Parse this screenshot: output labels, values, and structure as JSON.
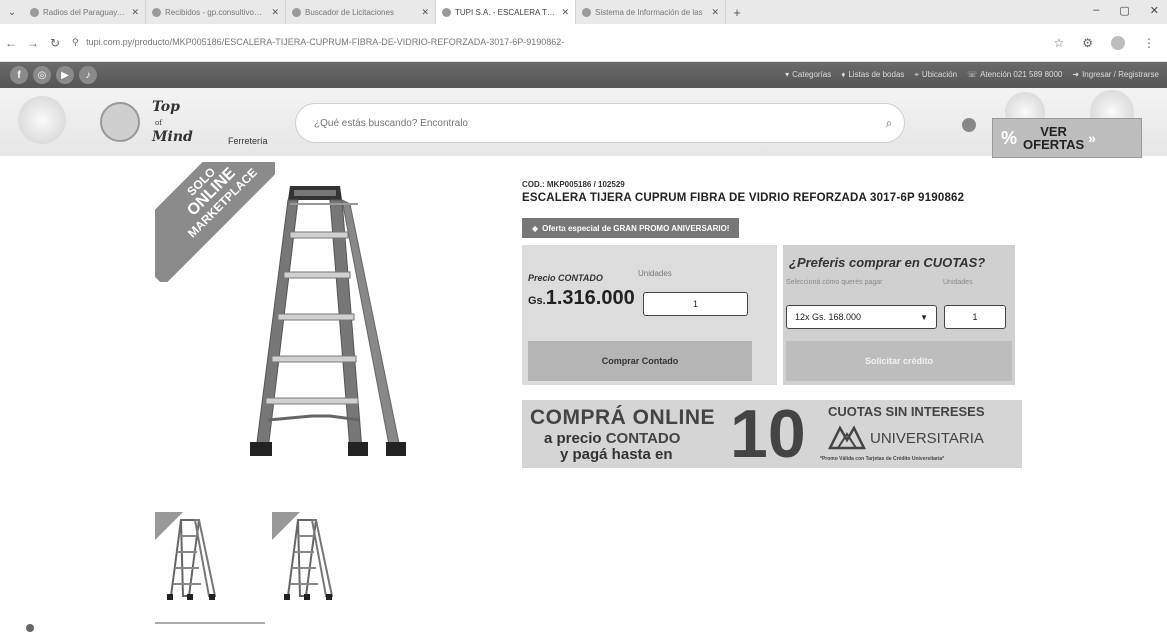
{
  "browser": {
    "tabs": [
      {
        "title": "Radios del Paraguay, emis",
        "active": false
      },
      {
        "title": "Recibidos - gp.consultivos@",
        "active": false
      },
      {
        "title": "Buscador de Licitaciones",
        "active": false
      },
      {
        "title": "TUPI S.A. - ESCALERA TIJERA",
        "active": true
      },
      {
        "title": "Sistema de Información de las",
        "active": false
      }
    ],
    "url": "tupi.com.py/producto/MKP005186/ESCALERA-TIJERA-CUPRUM-FIBRA-DE-VIDRIO-REFORZADA-3017-6P-9190862-"
  },
  "site_bar": {
    "social": [
      "f",
      "◎",
      "▶",
      "♪"
    ],
    "links": [
      {
        "icon": "▾",
        "label": "Categorías"
      },
      {
        "icon": "♦",
        "label": "Listas de bodas"
      },
      {
        "icon": "⌖",
        "label": "Ubicación"
      },
      {
        "icon": "☏",
        "label": "Atención 021 589 8000"
      },
      {
        "icon": "➜",
        "label": "Ingresar / Registrarse"
      }
    ]
  },
  "header": {
    "logo_line1": "Top",
    "logo_line2": "Mind",
    "logo_small": "of",
    "ferreteria": "Ferretería",
    "search_placeholder": "¿Qué estás buscando? Encontralo",
    "ver_ofertas_line1": "VER",
    "ver_ofertas_line2": "OFERTAS",
    "ver_ofertas_arrow": "»"
  },
  "product": {
    "ribbon_line1": "SOLO",
    "ribbon_line2": "ONLINE",
    "ribbon_line3": "MARKETPLACE",
    "code": "COD.: MKP005186 / 102529",
    "title": "ESCALERA TIJERA CUPRUM FIBRA DE VIDRIO REFORZADA 3017-6P 9190862",
    "promo": "Oferta especial de GRAN PROMO ANIVERSARIO!",
    "price_label": "Precio CONTADO",
    "units_label": "Unidades",
    "currency": "Gs.",
    "price": "1.316.000",
    "qty": "1",
    "buy_button": "Comprar Contado",
    "cuotas_title": "¿Preferis comprar en CUOTAS?",
    "cuotas_select_label": "Seleccioná cómo querés pagar",
    "cuotas_units_label": "Unidades",
    "cuotas_selected": "12x Gs. 168.000",
    "cuotas_qty": "1",
    "credit_button": "Solicitar crédito"
  },
  "banner": {
    "line1": "COMPRÁ ONLINE",
    "line2a": "a precio",
    "line2b": "CONTADO",
    "line3": "y pagá hasta en",
    "ten": "10",
    "cuotas": "CUOTAS SIN INTERESES",
    "brand": "UNIVERSITARIA",
    "note": "*Promo Válida con Tarjetas de Crédito Universitaria*"
  }
}
